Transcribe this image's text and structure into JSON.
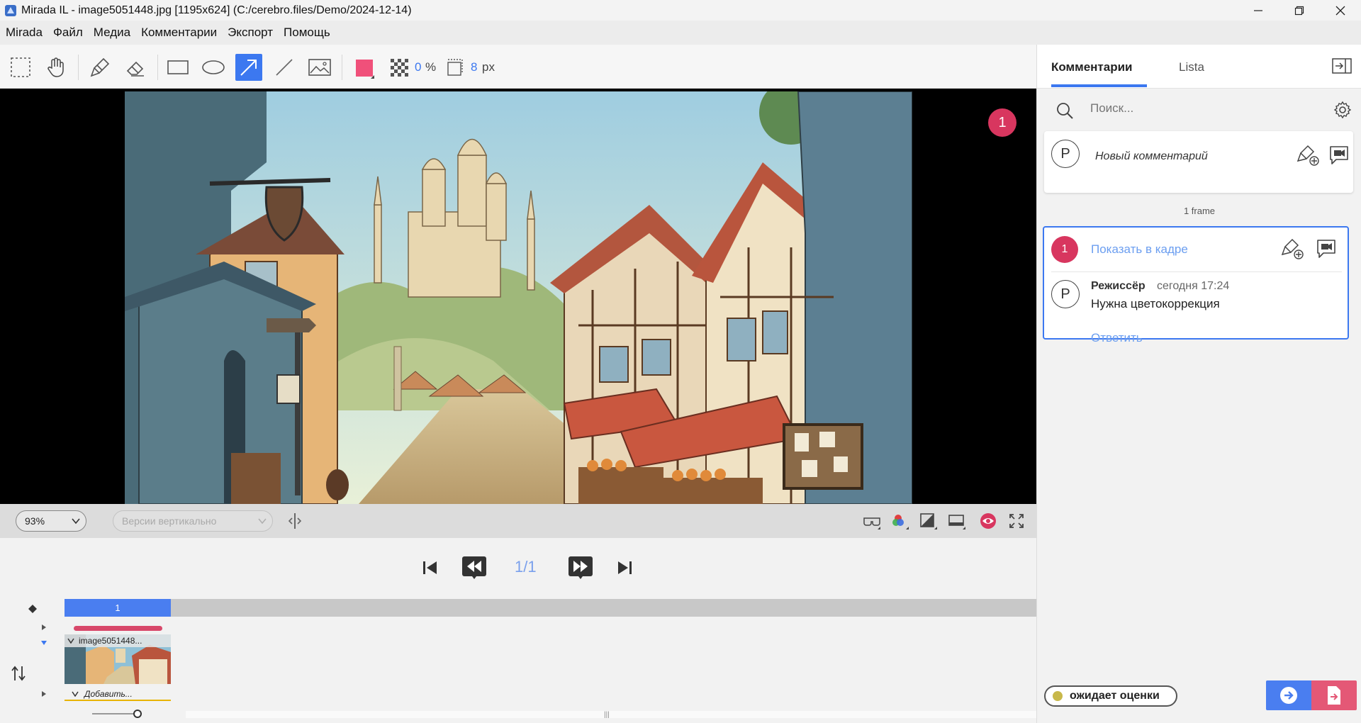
{
  "window": {
    "title": "Mirada IL - image5051448.jpg [1195x624] (C:/cerebro.files/Demo/2024-12-14)"
  },
  "menu": [
    "Mirada",
    "Файл",
    "Медиа",
    "Комментарии",
    "Экспорт",
    "Помощь"
  ],
  "toolbar": {
    "tools": [
      "select-rect",
      "hand",
      "brush",
      "eraser",
      "rectangle",
      "ellipse",
      "arrow",
      "line",
      "image"
    ],
    "active_tool": "arrow",
    "color": "#f0507a",
    "opacity_value": "0",
    "opacity_unit": "%",
    "stroke_value": "8",
    "stroke_unit": "px"
  },
  "viewer": {
    "marker_number": "1"
  },
  "viewbar": {
    "zoom": "93%",
    "versions_placeholder": "Версии вертикально",
    "icons": [
      "stereo-glasses-icon",
      "color-channels-icon",
      "exposure-icon",
      "display-icon",
      "eye-icon",
      "fullscreen-icon"
    ]
  },
  "playback": {
    "frame_counter": "1/1"
  },
  "timeline": {
    "active_frame": "1",
    "clip_name": "image5051448...",
    "add_track_label": "Добавить..."
  },
  "panel": {
    "tab_comments": "Комментарии",
    "tab_list": "Lista",
    "search_placeholder": "Поиск...",
    "new_comment_avatar": "P",
    "new_comment_placeholder": "Новый комментарий",
    "frame_group_label": "1 frame",
    "comment": {
      "badge": "1",
      "show_in_frame": "Показать в кадре",
      "avatar": "P",
      "author": "Режиссёр",
      "time": "сегодня 17:24",
      "text": "Нужна цветокоррекция",
      "reply": "Ответить"
    },
    "status": {
      "label": "ожидает оценки",
      "color": "#c8b84a"
    }
  },
  "colors": {
    "accent": "#3c78f0",
    "marker": "#d8365f",
    "link": "#6b9ef0"
  }
}
